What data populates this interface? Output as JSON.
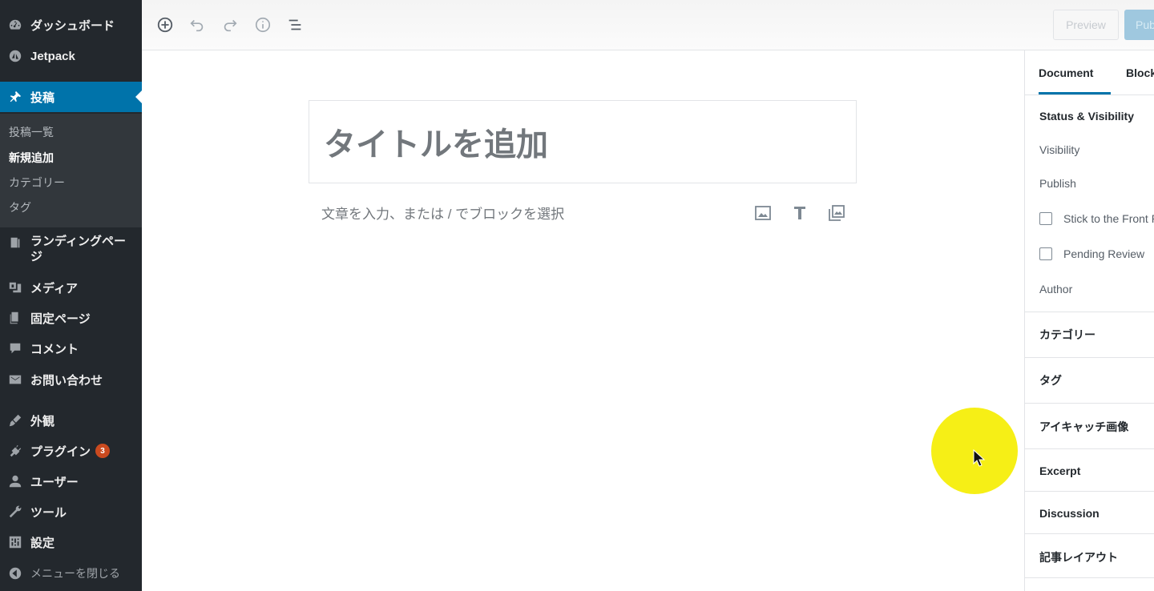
{
  "sidebar": {
    "items": [
      {
        "label": "ダッシュボード",
        "icon": "dashboard-icon"
      },
      {
        "label": "Jetpack",
        "icon": "jetpack-icon"
      },
      {
        "label": "投稿",
        "icon": "pin-icon"
      },
      {
        "label": "ランディングページ",
        "icon": "landing-page-icon"
      },
      {
        "label": "メディア",
        "icon": "media-icon"
      },
      {
        "label": "固定ページ",
        "icon": "pages-icon"
      },
      {
        "label": "コメント",
        "icon": "comment-icon"
      },
      {
        "label": "お問い合わせ",
        "icon": "mail-icon"
      },
      {
        "label": "外観",
        "icon": "appearance-icon"
      },
      {
        "label": "プラグイン",
        "icon": "plugin-icon",
        "badge": "3"
      },
      {
        "label": "ユーザー",
        "icon": "user-icon"
      },
      {
        "label": "ツール",
        "icon": "wrench-icon"
      },
      {
        "label": "設定",
        "icon": "settings-icon"
      },
      {
        "label": "メニューを閉じる",
        "icon": "collapse-icon"
      }
    ],
    "submenu": [
      {
        "label": "投稿一覧"
      },
      {
        "label": "新規追加"
      },
      {
        "label": "カテゴリー"
      },
      {
        "label": "タグ"
      }
    ]
  },
  "toolbar": {
    "preview_label": "Preview",
    "publish_label": "Publish",
    "icons": [
      "add-block-icon",
      "undo-icon",
      "redo-icon",
      "info-icon",
      "outline-icon"
    ]
  },
  "editor": {
    "title_placeholder": "タイトルを追加",
    "body_placeholder": "文章を入力、または / でブロックを選択",
    "inserter_icons": [
      "image-icon",
      "heading-icon",
      "gallery-icon"
    ]
  },
  "panel": {
    "tabs": [
      "Document",
      "Block"
    ],
    "status_heading": "Status & Visibility",
    "visibility_label": "Visibility",
    "publish_label": "Publish",
    "stick_label": "Stick to the Front Page",
    "pending_label": "Pending Review",
    "author_label": "Author",
    "sections": [
      "カテゴリー",
      "タグ",
      "アイキャッチ画像",
      "Excerpt",
      "Discussion",
      "記事レイアウト"
    ]
  },
  "colors": {
    "sidebar_bg": "#23282d",
    "accent": "#0073aa",
    "badge": "#ca4a1f",
    "cursor_highlight": "#f6ef16"
  }
}
